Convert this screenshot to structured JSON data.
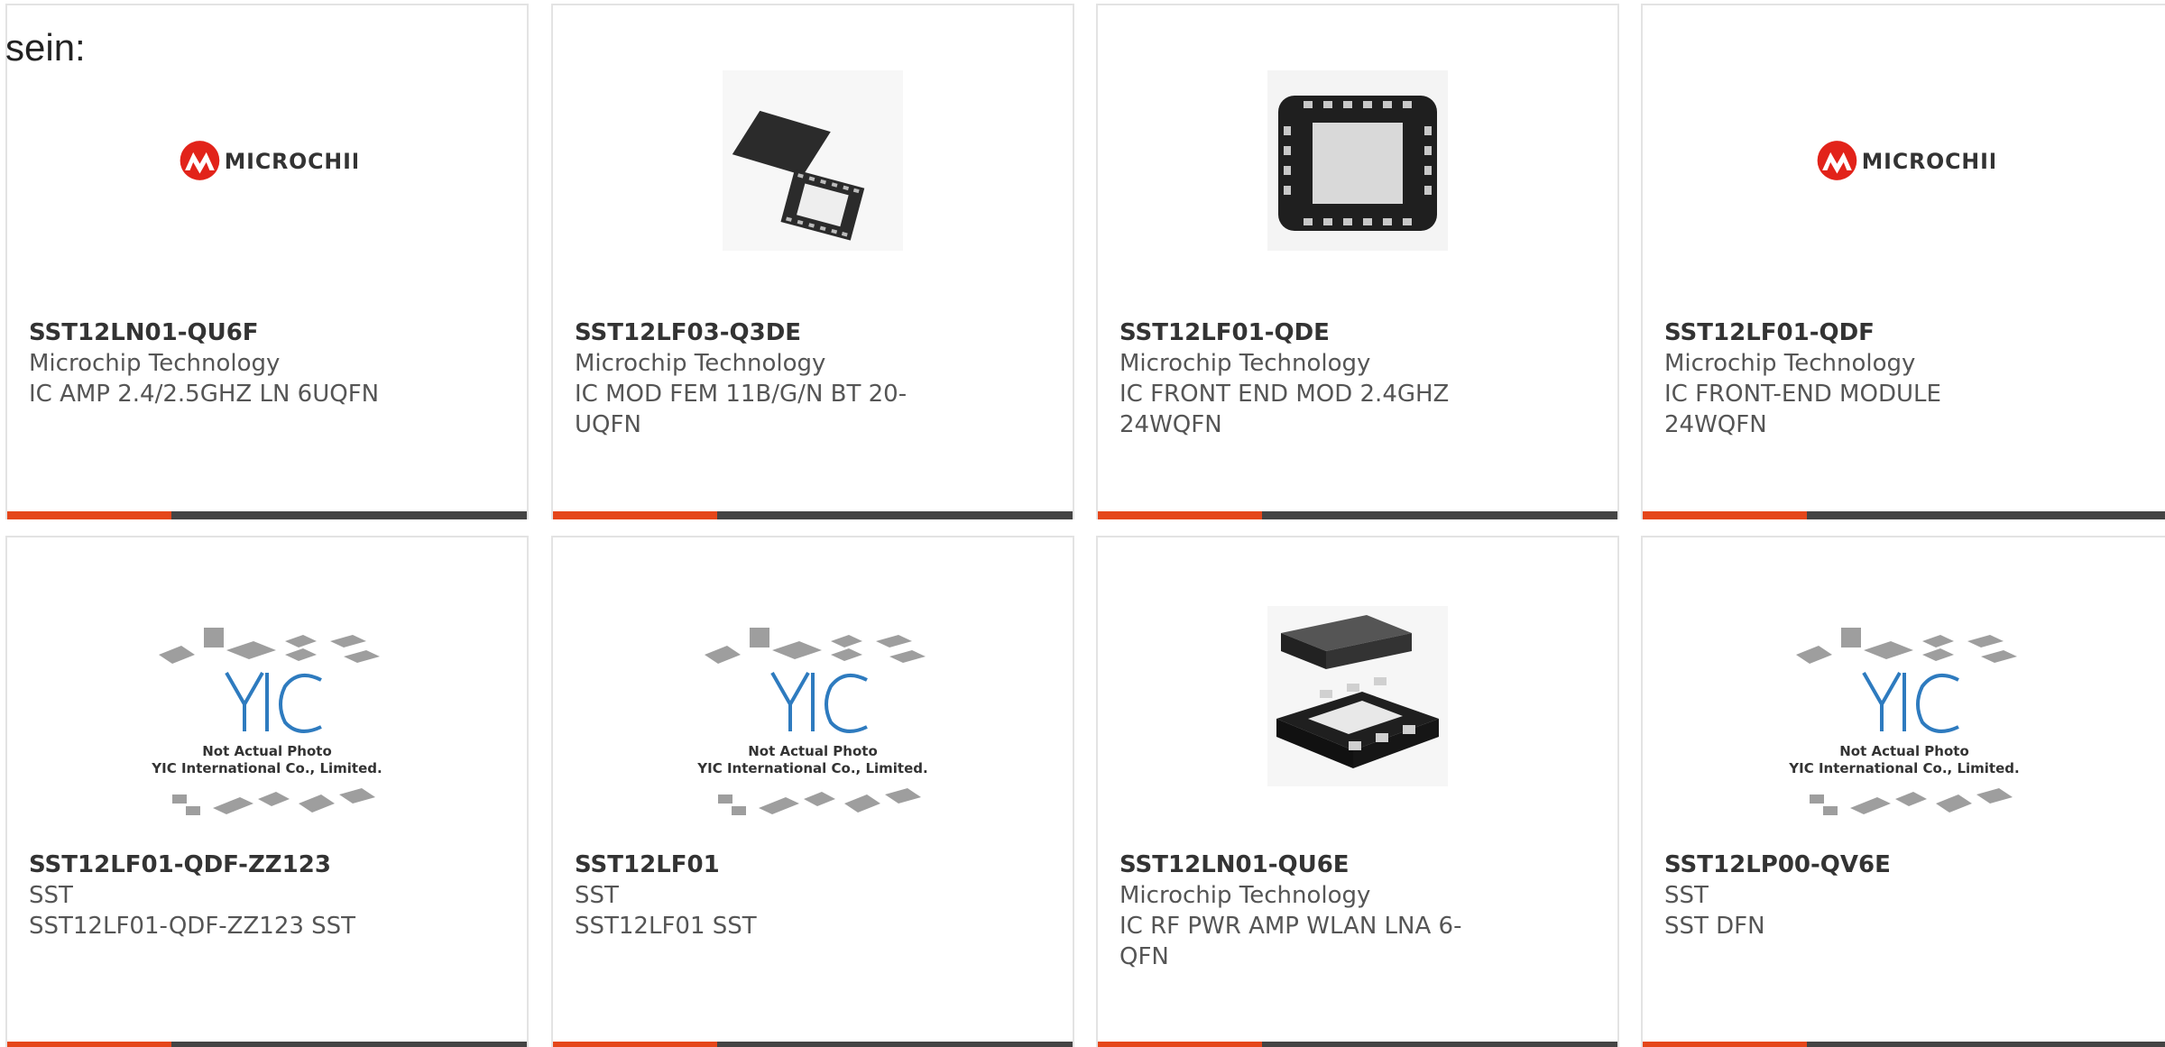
{
  "intro_text": "sein:",
  "colors": {
    "accent": "#e5461a",
    "bar": "#444444",
    "border": "#e3e3e3",
    "microchip_red": "#e2231a"
  },
  "placeholder_image": {
    "line1": "Not Actual Photo",
    "line2": "YIC International Co., Limited."
  },
  "products": [
    {
      "part": "SST12LN01-QU6F",
      "manufacturer": "Microchip Technology",
      "description": "IC AMP 2.4/2.5GHZ LN 6UQFN",
      "image": "microchip-logo"
    },
    {
      "part": "SST12LF03-Q3DE",
      "manufacturer": "Microchip Technology",
      "description": "IC MOD FEM 11B/G/N BT 20-UQFN",
      "image": "uqfn-package-photo"
    },
    {
      "part": "SST12LF01-QDE",
      "manufacturer": "Microchip Technology",
      "description": "IC FRONT END MOD 2.4GHZ 24WQFN",
      "image": "wqfn-package-photo"
    },
    {
      "part": "SST12LF01-QDF",
      "manufacturer": "Microchip Technology",
      "description": "IC FRONT-END MODULE 24WQFN",
      "image": "microchip-logo"
    },
    {
      "part": "SST12LF01-QDF-ZZ123",
      "manufacturer": "SST",
      "description": "SST12LF01-QDF-ZZ123 SST",
      "image": "yic-placeholder"
    },
    {
      "part": "SST12LF01",
      "manufacturer": "SST",
      "description": "SST12LF01 SST",
      "image": "yic-placeholder"
    },
    {
      "part": "SST12LN01-QU6E",
      "manufacturer": "Microchip Technology",
      "description": "IC RF PWR AMP WLAN LNA 6-QFN",
      "image": "dfn-package-photo"
    },
    {
      "part": "SST12LP00-QV6E",
      "manufacturer": "SST",
      "description": "SST DFN",
      "image": "yic-placeholder"
    }
  ]
}
